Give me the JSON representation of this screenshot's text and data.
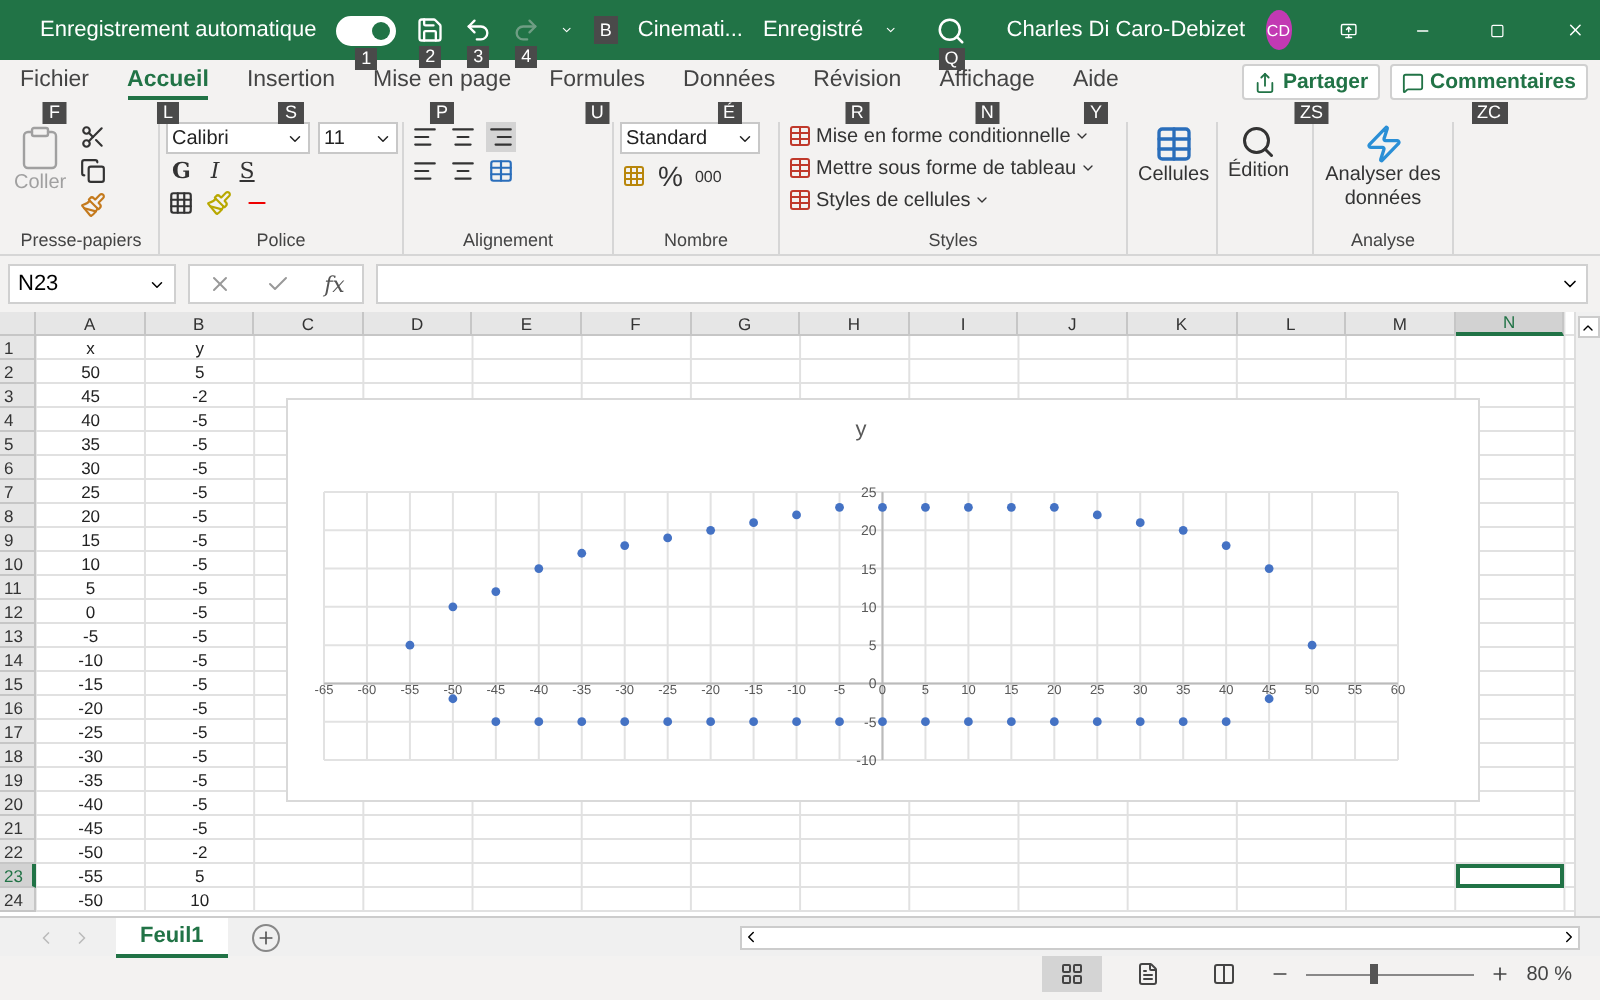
{
  "title_bar": {
    "autosave_label": "Enregistrement automatique",
    "autosave_on": true,
    "autosave_keytip": "1",
    "file_name": "Cinemati...",
    "file_keytip": "B",
    "file_status": "Enregistré",
    "search_keytip": "Q",
    "user_name": "Charles Di Caro-Debizet",
    "user_initials": "CD"
  },
  "quick_access": [
    {
      "kind": "save",
      "keytip": "2",
      "disabled": false
    },
    {
      "kind": "undo",
      "keytip": "3",
      "disabled": false
    },
    {
      "kind": "redo",
      "keytip": "4",
      "disabled": true
    }
  ],
  "ribbon_tabs": [
    {
      "label": "Fichier",
      "keytip": "F",
      "selected": false
    },
    {
      "label": "Accueil",
      "keytip": "L",
      "selected": true
    },
    {
      "label": "Insertion",
      "keytip": "S",
      "selected": false
    },
    {
      "label": "Mise en page",
      "keytip": "P",
      "selected": false
    },
    {
      "label": "Formules",
      "keytip": "U",
      "selected": false
    },
    {
      "label": "Données",
      "keytip": "É",
      "selected": false
    },
    {
      "label": "Révision",
      "keytip": "R",
      "selected": false
    },
    {
      "label": "Affichage",
      "keytip": "N",
      "selected": false
    },
    {
      "label": "Aide",
      "keytip": "Y",
      "selected": false
    }
  ],
  "share_button": {
    "label": "Partager",
    "keytip": "ZS"
  },
  "comments_button": {
    "label": "Commentaires",
    "keytip": "ZC"
  },
  "ribbon": {
    "clipboard": {
      "label": "Presse-papiers",
      "paste": "Coller",
      "paste_disabled": true
    },
    "font": {
      "label": "Police",
      "font_name": "Calibri",
      "font_size": "11",
      "bold": "G",
      "italic": "I",
      "underline": "S"
    },
    "alignment": {
      "label": "Alignement"
    },
    "number": {
      "label": "Nombre",
      "format": "Standard",
      "percent": "%",
      "thousands": "000"
    },
    "styles": {
      "label": "Styles",
      "items": [
        "Mise en forme conditionnelle",
        "Mettre sous forme de tableau",
        "Styles de cellules"
      ]
    },
    "cells": {
      "label": "Cellules"
    },
    "editing": {
      "label": "Édition"
    },
    "analysis": {
      "label": "Analyse",
      "button": "Analyser des données"
    }
  },
  "formula_bar": {
    "name_box": "N23",
    "fx": "fx"
  },
  "sheet": {
    "columns": [
      {
        "label": "A",
        "selected": false
      },
      {
        "label": "B",
        "selected": false
      },
      {
        "label": "C",
        "selected": false
      },
      {
        "label": "D",
        "selected": false
      },
      {
        "label": "E",
        "selected": false
      },
      {
        "label": "F",
        "selected": false
      },
      {
        "label": "G",
        "selected": false
      },
      {
        "label": "H",
        "selected": false
      },
      {
        "label": "I",
        "selected": false
      },
      {
        "label": "J",
        "selected": false
      },
      {
        "label": "K",
        "selected": false
      },
      {
        "label": "L",
        "selected": false
      },
      {
        "label": "M",
        "selected": false
      },
      {
        "label": "N",
        "selected": true
      }
    ],
    "rows": [
      {
        "number": "1",
        "selected": false,
        "cells": [
          "x",
          "y"
        ]
      },
      {
        "number": "2",
        "selected": false,
        "cells": [
          "50",
          "5"
        ]
      },
      {
        "number": "3",
        "selected": false,
        "cells": [
          "45",
          "-2"
        ]
      },
      {
        "number": "4",
        "selected": false,
        "cells": [
          "40",
          "-5"
        ]
      },
      {
        "number": "5",
        "selected": false,
        "cells": [
          "35",
          "-5"
        ]
      },
      {
        "number": "6",
        "selected": false,
        "cells": [
          "30",
          "-5"
        ]
      },
      {
        "number": "7",
        "selected": false,
        "cells": [
          "25",
          "-5"
        ]
      },
      {
        "number": "8",
        "selected": false,
        "cells": [
          "20",
          "-5"
        ]
      },
      {
        "number": "9",
        "selected": false,
        "cells": [
          "15",
          "-5"
        ]
      },
      {
        "number": "10",
        "selected": false,
        "cells": [
          "10",
          "-5"
        ]
      },
      {
        "number": "11",
        "selected": false,
        "cells": [
          "5",
          "-5"
        ]
      },
      {
        "number": "12",
        "selected": false,
        "cells": [
          "0",
          "-5"
        ]
      },
      {
        "number": "13",
        "selected": false,
        "cells": [
          "-5",
          "-5"
        ]
      },
      {
        "number": "14",
        "selected": false,
        "cells": [
          "-10",
          "-5"
        ]
      },
      {
        "number": "15",
        "selected": false,
        "cells": [
          "-15",
          "-5"
        ]
      },
      {
        "number": "16",
        "selected": false,
        "cells": [
          "-20",
          "-5"
        ]
      },
      {
        "number": "17",
        "selected": false,
        "cells": [
          "-25",
          "-5"
        ]
      },
      {
        "number": "18",
        "selected": false,
        "cells": [
          "-30",
          "-5"
        ]
      },
      {
        "number": "19",
        "selected": false,
        "cells": [
          "-35",
          "-5"
        ]
      },
      {
        "number": "20",
        "selected": false,
        "cells": [
          "-40",
          "-5"
        ]
      },
      {
        "number": "21",
        "selected": false,
        "cells": [
          "-45",
          "-5"
        ]
      },
      {
        "number": "22",
        "selected": false,
        "cells": [
          "-50",
          "-2"
        ]
      },
      {
        "number": "23",
        "selected": true,
        "cells": [
          "-55",
          "5"
        ]
      },
      {
        "number": "24",
        "selected": false,
        "cells": [
          "-50",
          "10"
        ]
      }
    ],
    "chart_data": {
      "type": "scatter",
      "grid": true,
      "x": [
        50,
        45,
        40,
        35,
        30,
        25,
        20,
        15,
        10,
        5,
        0,
        -5,
        -10,
        -15,
        -20,
        -25,
        -30,
        -35,
        -40,
        -45,
        -50,
        -55,
        -50,
        -45,
        -40,
        -35,
        -30,
        -25,
        -20,
        -15,
        -10,
        -5,
        0,
        5,
        10,
        15,
        20,
        25,
        30,
        35,
        40,
        45
      ],
      "series": [
        {
          "name": "y",
          "color": "#4472c4",
          "values": [
            5,
            -2,
            -5,
            -5,
            -5,
            -5,
            -5,
            -5,
            -5,
            -5,
            -5,
            -5,
            -5,
            -5,
            -5,
            -5,
            -5,
            -5,
            -5,
            -5,
            -2,
            5,
            10,
            12,
            15,
            17,
            18,
            19,
            20,
            21,
            22,
            23,
            23,
            23,
            23,
            23,
            23,
            22,
            21,
            20,
            18,
            15
          ]
        }
      ],
      "xlim": [
        -65,
        60
      ],
      "ylim": [
        -10,
        25
      ],
      "xticks": [
        -65,
        -60,
        -55,
        -50,
        -45,
        -40,
        -35,
        -30,
        -25,
        -20,
        -15,
        -10,
        -5,
        0,
        5,
        10,
        15,
        20,
        25,
        30,
        35,
        40,
        45,
        50,
        55,
        60
      ],
      "yticks": [
        -10,
        -5,
        0,
        5,
        10,
        15,
        20,
        25
      ]
    }
  },
  "sheet_tabs": [
    {
      "label": "Feuil1",
      "selected": true
    }
  ],
  "status_bar": {
    "views": [
      {
        "kind": "normal",
        "selected": true
      },
      {
        "kind": "page_layout",
        "selected": false
      },
      {
        "kind": "page_break",
        "selected": false
      }
    ],
    "zoom_slider": {
      "level": 0.4
    },
    "zoom": "80 %"
  }
}
